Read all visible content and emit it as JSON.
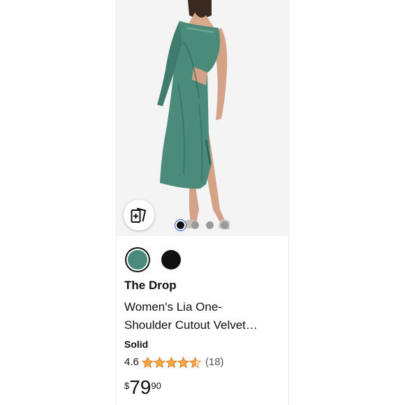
{
  "product": {
    "brand": "The Drop",
    "title_line1": "Women's Lia One-",
    "title_line2": "Shoulder Cutout Velvet…",
    "variant": "Solid",
    "rating": "4.6",
    "rating_value": 4.6,
    "review_count": "(18)",
    "price_symbol": "$",
    "price_whole": "79",
    "price_fraction": "90"
  },
  "gallery": {
    "image_count": 4,
    "active_index": 0,
    "compare_icon": "compare-cards-icon"
  },
  "swatches": [
    {
      "name": "green-velvet",
      "color": "#4a8b7a",
      "selected": true
    },
    {
      "name": "black",
      "color": "#111111",
      "selected": false
    }
  ],
  "colors": {
    "star": "#f3a847",
    "dress": "#4a8b7a",
    "dress_shadow": "#2f6658"
  }
}
